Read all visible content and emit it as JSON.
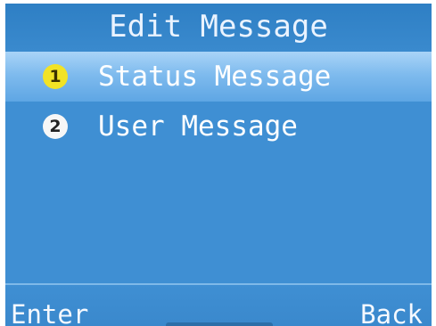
{
  "screen": {
    "title": "Edit Message"
  },
  "menu": {
    "items": [
      {
        "number": "1",
        "label": "Status Message",
        "selected": true
      },
      {
        "number": "2",
        "label": "User Message",
        "selected": false
      }
    ]
  },
  "softkeys": {
    "left_label": "Enter",
    "right_label": "Back"
  },
  "colors": {
    "background": "#3f8fd3",
    "highlight": "#7fbbee",
    "badge_selected": "#f2e326",
    "badge_default": "#f7f7f7",
    "text": "#ffffff"
  }
}
